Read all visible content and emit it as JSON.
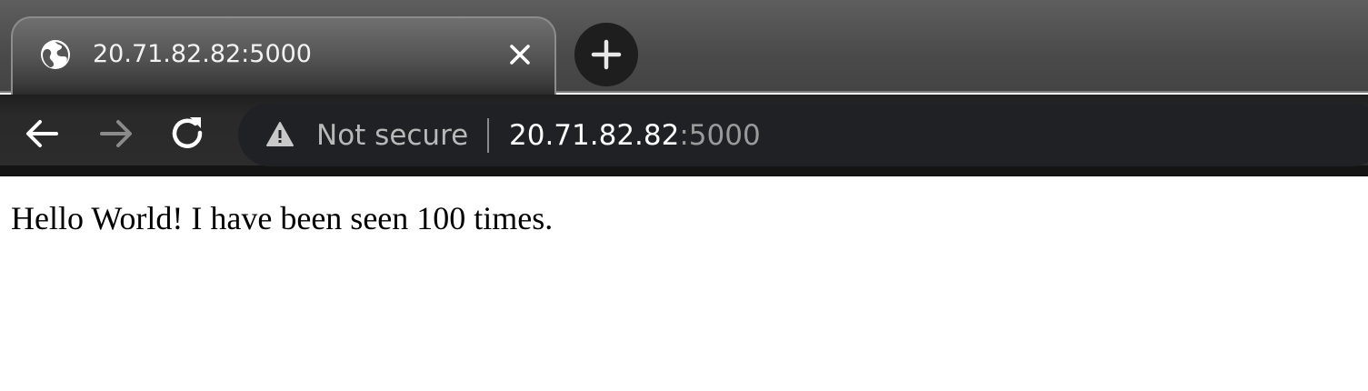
{
  "tab": {
    "title": "20.71.82.82:5000",
    "favicon": "globe-icon",
    "close_icon": "close-icon"
  },
  "toolbar": {
    "new_tab_icon": "plus-icon",
    "back_icon": "arrow-left-icon",
    "forward_icon": "arrow-right-icon",
    "reload_icon": "reload-icon"
  },
  "omnibox": {
    "security_icon": "warning-triangle-icon",
    "security_label": "Not secure",
    "url_host": "20.71.82.82",
    "url_port": ":5000"
  },
  "page": {
    "message": "Hello World! I have been seen 100 times."
  },
  "colors": {
    "toolbar": "#2c2c2c",
    "omnibox": "#202124",
    "page_background": "#ffffff"
  }
}
